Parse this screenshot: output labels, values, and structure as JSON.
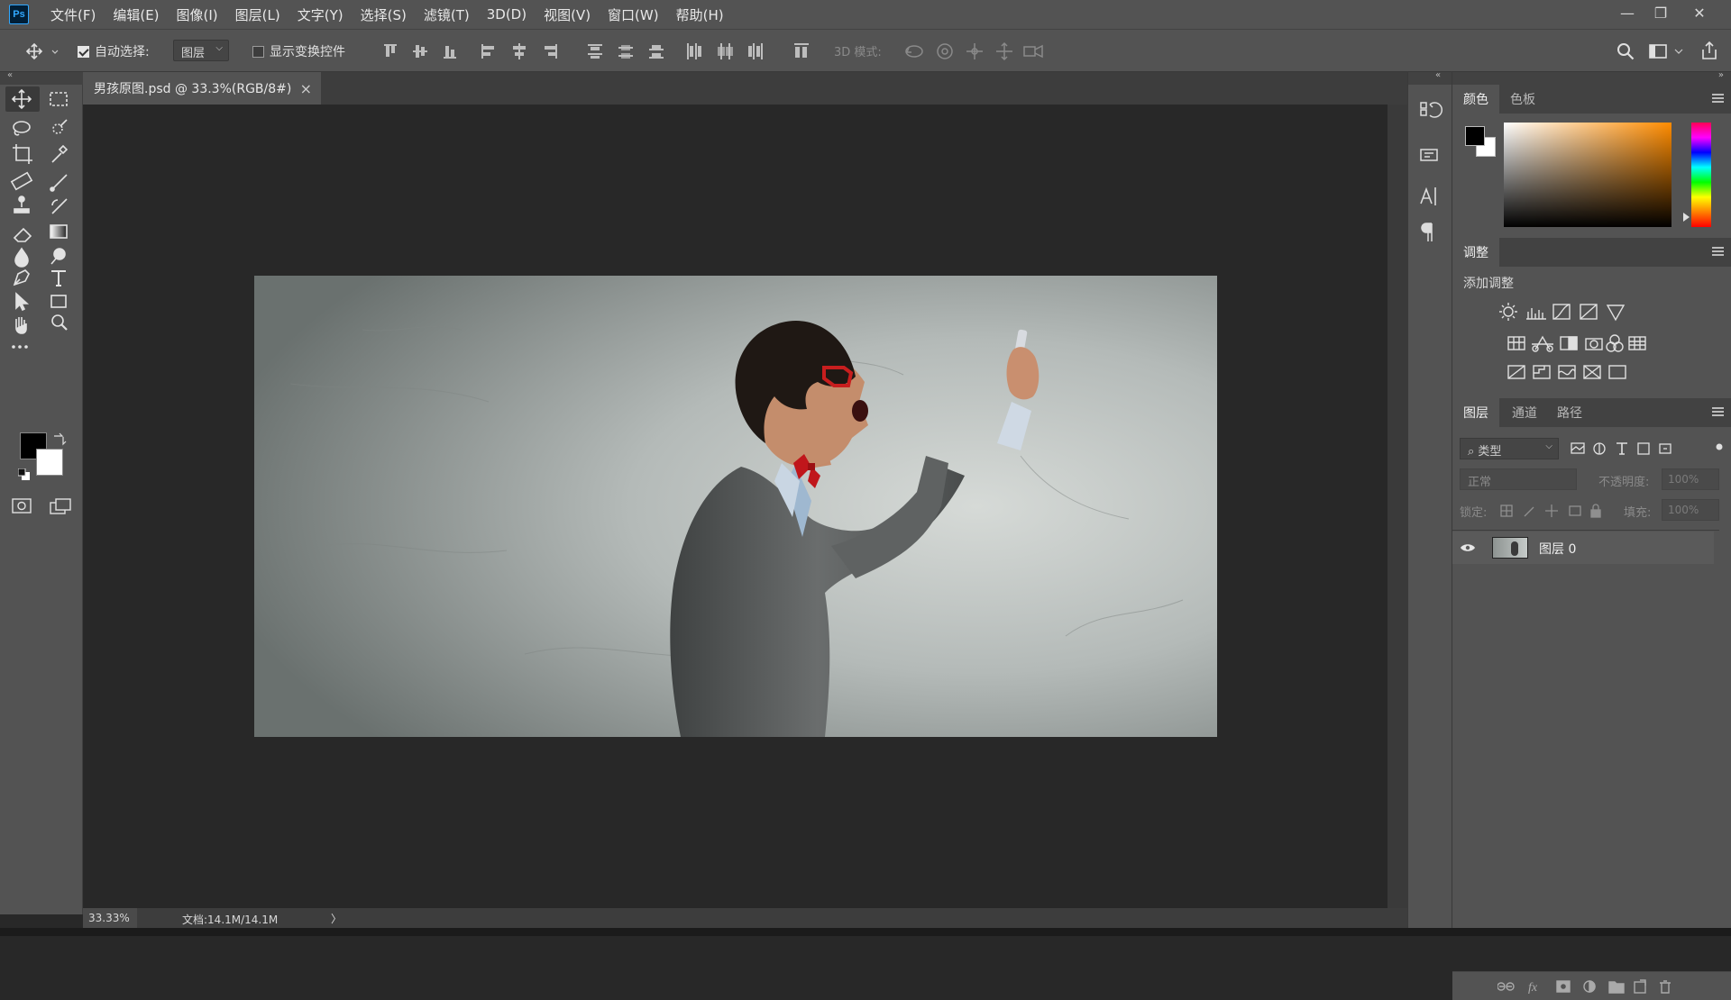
{
  "app": {
    "logo": "Ps"
  },
  "menu": [
    "文件(F)",
    "编辑(E)",
    "图像(I)",
    "图层(L)",
    "文字(Y)",
    "选择(S)",
    "滤镜(T)",
    "3D(D)",
    "视图(V)",
    "窗口(W)",
    "帮助(H)"
  ],
  "window_controls": {
    "minimize": "—",
    "restore": "❐",
    "close": "✕"
  },
  "options": {
    "auto_select_label": "自动选择:",
    "auto_select_checked": true,
    "auto_select_target": "图层",
    "show_transform_label": "显示变换控件",
    "mode_3d_label": "3D 模式:"
  },
  "document": {
    "tab_title": "男孩原图.psd @ 33.3%(RGB/8#)",
    "close_glyph": "×"
  },
  "status": {
    "zoom": "33.33%",
    "doc_info": "文档:14.1M/14.1M",
    "arrow": "〉"
  },
  "panels": {
    "color": {
      "tabs": [
        "颜色",
        "色板"
      ],
      "active_tab": "颜色",
      "foreground": "#000000",
      "background": "#ffffff",
      "hue_color": "#ff8c00"
    },
    "adjustments": {
      "title": "调整",
      "subtitle": "添加调整"
    },
    "layers": {
      "tabs": [
        "图层",
        "通道",
        "路径"
      ],
      "active_tab": "图层",
      "filter_label": "类型",
      "blend_mode": "正常",
      "opacity_label": "不透明度:",
      "opacity_value": "100%",
      "lock_label": "锁定:",
      "fill_label": "填充:",
      "fill_value": "100%",
      "items": [
        {
          "name": "图层 0",
          "visible": true
        }
      ]
    }
  },
  "tool_colors": {
    "foreground": "#000000",
    "background": "#ffffff"
  }
}
